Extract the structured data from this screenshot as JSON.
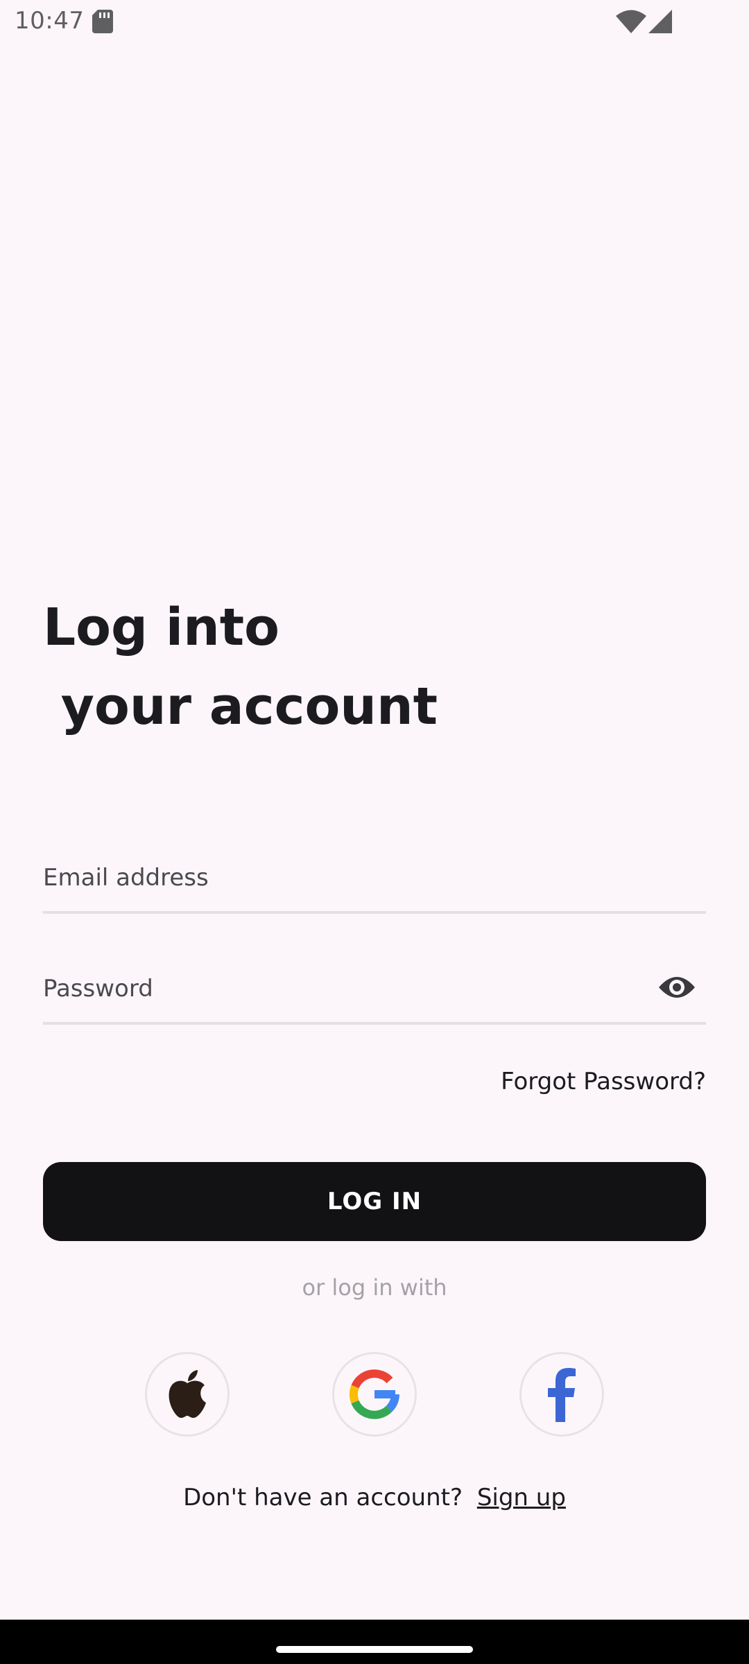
{
  "status_bar": {
    "time": "10:47",
    "icons": [
      "sd-card-icon",
      "wifi-icon",
      "signal-icon"
    ]
  },
  "title": {
    "line1": "Log into",
    "line2": " your account"
  },
  "form": {
    "email_placeholder": "Email address",
    "email_value": "",
    "password_placeholder": "Password",
    "password_value": "",
    "password_toggle_icon": "eye-icon",
    "forgot_password": "Forgot Password?"
  },
  "login_button": "LOG IN",
  "social": {
    "divider_text": "or log in with",
    "providers": [
      "apple-icon",
      "google-icon",
      "facebook-icon"
    ]
  },
  "signup": {
    "prompt": "Don't have an account?",
    "link": "Sign up"
  },
  "colors": {
    "background": "#fcf6fb",
    "button": "#121113",
    "facebook": "#3b66d4"
  }
}
